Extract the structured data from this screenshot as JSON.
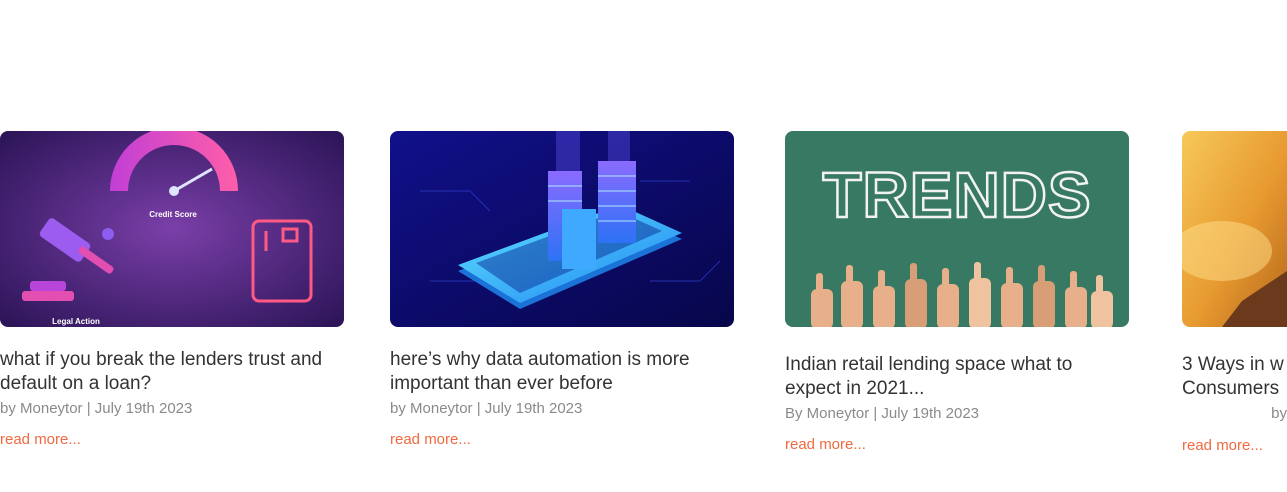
{
  "cards": [
    {
      "image_alt": "Credit score meter with legal gavel and credit card",
      "image_labels": {
        "top": "Credit Score",
        "bottom": "Legal Action"
      },
      "title": "what if you break the lenders trust and default on a loan?",
      "meta": "by Moneytor | July 19th 2023",
      "link": "read more..."
    },
    {
      "image_alt": "Isometric city buildings on a smartphone",
      "title": "here’s why data automation is more important than ever before",
      "meta": "by Moneytor | July 19th 2023",
      "link": "read more..."
    },
    {
      "image_alt": "TRENDS written on a green chalkboard with thumbs up hands",
      "image_labels": {
        "word": "TRENDS"
      },
      "title": "Indian retail lending space what to expect in 2021...",
      "meta": "By Moneytor | July 19th 2023",
      "link": "read more..."
    },
    {
      "image_alt": "Hand raised against an orange sunset sky",
      "title_lines": [
        "3 Ways in w",
        "Consumers"
      ],
      "meta": "by",
      "link": "read more..."
    }
  ],
  "colors": {
    "link": "#ef6a3f",
    "title": "#333333",
    "meta": "#8a8a8a"
  }
}
